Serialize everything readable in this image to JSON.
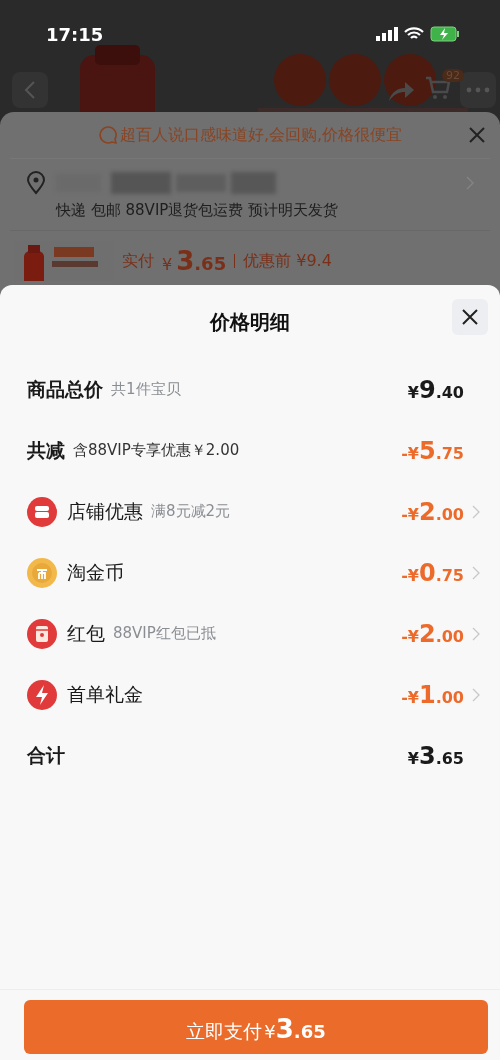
{
  "status_bar": {
    "time": "17:15"
  },
  "product_page": {
    "cart_badge": "92"
  },
  "order_sheet": {
    "review_banner": "超百人说口感味道好,会回购,价格很便宜",
    "delivery": "快递 包邮 88VIP退货包运费 预计明天发货",
    "pay_label": "实付",
    "pay_price": {
      "prefix": "¥",
      "integer": "3",
      "decimal": ".65"
    },
    "before_discount": "优惠前 ¥9.4"
  },
  "price_detail": {
    "title": "价格明细",
    "rows": [
      {
        "kind": "total",
        "label": "商品总价",
        "note": "共1件宝贝",
        "amount": {
          "prefix": "¥",
          "integer": "9",
          "decimal": ".40"
        }
      },
      {
        "kind": "discount",
        "label": "共减",
        "note": "含88VIP专享优惠￥2.00",
        "amount": {
          "prefix": "-¥",
          "integer": "5",
          "decimal": ".75"
        }
      },
      {
        "kind": "shop",
        "label": "店铺优惠",
        "note": "满8元减2元",
        "amount": {
          "prefix": "-¥",
          "integer": "2",
          "decimal": ".00"
        }
      },
      {
        "kind": "coin",
        "label": "淘金币",
        "amount": {
          "prefix": "-¥",
          "integer": "0",
          "decimal": ".75"
        }
      },
      {
        "kind": "packet",
        "label": "红包",
        "note": "88VIP红包已抵",
        "amount": {
          "prefix": "-¥",
          "integer": "2",
          "decimal": ".00"
        }
      },
      {
        "kind": "bolt",
        "label": "首单礼金",
        "amount": {
          "prefix": "-¥",
          "integer": "1",
          "decimal": ".00"
        }
      },
      {
        "kind": "sum",
        "label": "合计",
        "amount": {
          "prefix": "¥",
          "integer": "3",
          "decimal": ".65"
        }
      }
    ],
    "pay_button": {
      "label": "立即支付",
      "prefix": "¥",
      "integer": "3",
      "decimal": ".65"
    }
  }
}
